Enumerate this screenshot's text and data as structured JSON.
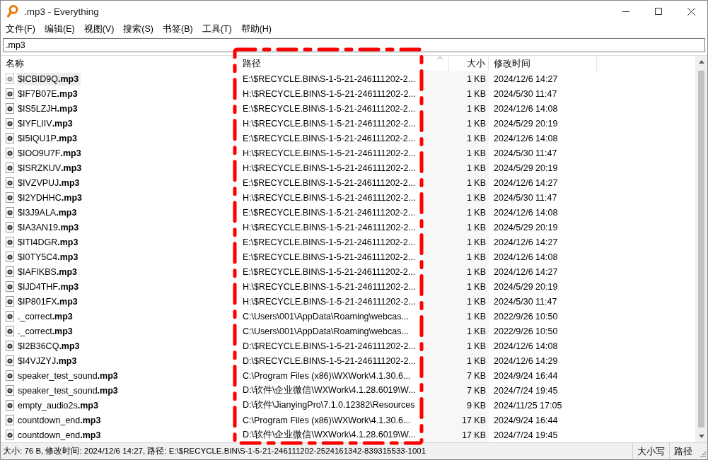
{
  "window": {
    "title": ".mp3 - Everything"
  },
  "menu": [
    "文件(F)",
    "编辑(E)",
    "视图(V)",
    "搜索(S)",
    "书签(B)",
    "工具(T)",
    "帮助(H)"
  ],
  "search": {
    "value": ".mp3"
  },
  "table": {
    "columns": [
      {
        "label": "名称",
        "sorted": false
      },
      {
        "label": "路径",
        "sorted": true
      },
      {
        "label": "大小",
        "sorted": false
      },
      {
        "label": "修改时间",
        "sorted": false
      }
    ],
    "rows": [
      {
        "name": "$ICBID9Q**.mp3**",
        "path": "E:\\$RECYCLE.BIN\\S-1-5-21-246111202-2...",
        "size": "1 KB",
        "modified": "2024/12/6 14:27",
        "selected": true
      },
      {
        "name": "$IF7B07E**.mp3**",
        "path": "H:\\$RECYCLE.BIN\\S-1-5-21-246111202-2...",
        "size": "1 KB",
        "modified": "2024/5/30 11:47",
        "selected": false
      },
      {
        "name": "$IS5LZJH**.mp3**",
        "path": "E:\\$RECYCLE.BIN\\S-1-5-21-246111202-2...",
        "size": "1 KB",
        "modified": "2024/12/6 14:08",
        "selected": false
      },
      {
        "name": "$IYFLIIV**.mp3**",
        "path": "H:\\$RECYCLE.BIN\\S-1-5-21-246111202-2...",
        "size": "1 KB",
        "modified": "2024/5/29 20:19",
        "selected": false
      },
      {
        "name": "$I5IQU1P**.mp3**",
        "path": "E:\\$RECYCLE.BIN\\S-1-5-21-246111202-2...",
        "size": "1 KB",
        "modified": "2024/12/6 14:08",
        "selected": false
      },
      {
        "name": "$IOO9U7F**.mp3**",
        "path": "H:\\$RECYCLE.BIN\\S-1-5-21-246111202-2...",
        "size": "1 KB",
        "modified": "2024/5/30 11:47",
        "selected": false
      },
      {
        "name": "$ISRZKUV**.mp3**",
        "path": "H:\\$RECYCLE.BIN\\S-1-5-21-246111202-2...",
        "size": "1 KB",
        "modified": "2024/5/29 20:19",
        "selected": false
      },
      {
        "name": "$IVZVPUJ**.mp3**",
        "path": "E:\\$RECYCLE.BIN\\S-1-5-21-246111202-2...",
        "size": "1 KB",
        "modified": "2024/12/6 14:27",
        "selected": false
      },
      {
        "name": "$I2YDHHC**.mp3**",
        "path": "H:\\$RECYCLE.BIN\\S-1-5-21-246111202-2...",
        "size": "1 KB",
        "modified": "2024/5/30 11:47",
        "selected": false
      },
      {
        "name": "$I3J9ALA**.mp3**",
        "path": "E:\\$RECYCLE.BIN\\S-1-5-21-246111202-2...",
        "size": "1 KB",
        "modified": "2024/12/6 14:08",
        "selected": false
      },
      {
        "name": "$IA3AN19**.mp3**",
        "path": "H:\\$RECYCLE.BIN\\S-1-5-21-246111202-2...",
        "size": "1 KB",
        "modified": "2024/5/29 20:19",
        "selected": false
      },
      {
        "name": "$ITI4DGR**.mp3**",
        "path": "E:\\$RECYCLE.BIN\\S-1-5-21-246111202-2...",
        "size": "1 KB",
        "modified": "2024/12/6 14:27",
        "selected": false
      },
      {
        "name": "$I0TY5C4**.mp3**",
        "path": "E:\\$RECYCLE.BIN\\S-1-5-21-246111202-2...",
        "size": "1 KB",
        "modified": "2024/12/6 14:08",
        "selected": false
      },
      {
        "name": "$IAFIKBS**.mp3**",
        "path": "E:\\$RECYCLE.BIN\\S-1-5-21-246111202-2...",
        "size": "1 KB",
        "modified": "2024/12/6 14:27",
        "selected": false
      },
      {
        "name": "$IJD4THF**.mp3**",
        "path": "H:\\$RECYCLE.BIN\\S-1-5-21-246111202-2...",
        "size": "1 KB",
        "modified": "2024/5/29 20:19",
        "selected": false
      },
      {
        "name": "$IP801FX**.mp3**",
        "path": "H:\\$RECYCLE.BIN\\S-1-5-21-246111202-2...",
        "size": "1 KB",
        "modified": "2024/5/30 11:47",
        "selected": false
      },
      {
        "name": "._correct**.mp3**",
        "path": "C:\\Users\\001\\AppData\\Roaming\\webcas...",
        "size": "1 KB",
        "modified": "2022/9/26 10:50",
        "selected": false
      },
      {
        "name": "._correct**.mp3**",
        "path": "C:\\Users\\001\\AppData\\Roaming\\webcas...",
        "size": "1 KB",
        "modified": "2022/9/26 10:50",
        "selected": false
      },
      {
        "name": "$I2B36CQ**.mp3**",
        "path": "D:\\$RECYCLE.BIN\\S-1-5-21-246111202-2...",
        "size": "1 KB",
        "modified": "2024/12/6 14:08",
        "selected": false
      },
      {
        "name": "$I4VJZYJ**.mp3**",
        "path": "D:\\$RECYCLE.BIN\\S-1-5-21-246111202-2...",
        "size": "1 KB",
        "modified": "2024/12/6 14:29",
        "selected": false
      },
      {
        "name": "speaker_test_sound**.mp3**",
        "path": "C:\\Program Files (x86)\\WXWork\\4.1.30.6...",
        "size": "7 KB",
        "modified": "2024/9/24 16:44",
        "selected": false
      },
      {
        "name": "speaker_test_sound**.mp3**",
        "path": "D:\\软件\\企业微信\\WXWork\\4.1.28.6019\\W...",
        "size": "7 KB",
        "modified": "2024/7/24 19:45",
        "selected": false
      },
      {
        "name": "empty_audio2s**.mp3**",
        "path": "D:\\软件\\JianyingPro\\7.1.0.12382\\Resources",
        "size": "9 KB",
        "modified": "2024/11/25 17:05",
        "selected": false
      },
      {
        "name": "countdown_end**.mp3**",
        "path": "C:\\Program Files (x86)\\WXWork\\4.1.30.6...",
        "size": "17 KB",
        "modified": "2024/9/24 16:44",
        "selected": false
      },
      {
        "name": "countdown_end**.mp3**",
        "path": "D:\\软件\\企业微信\\WXWork\\4.1.28.6019\\W...",
        "size": "17 KB",
        "modified": "2024/7/24 19:45",
        "selected": false
      }
    ]
  },
  "status_bar": {
    "text": "大小: 76 B, 修改时间: 2024/12/6 14:27, 路径: E:\\$RECYCLE.BIN\\S-1-5-21-246111202-2524161342-839315533-1001",
    "toggles": [
      "大小写",
      "路径"
    ]
  }
}
